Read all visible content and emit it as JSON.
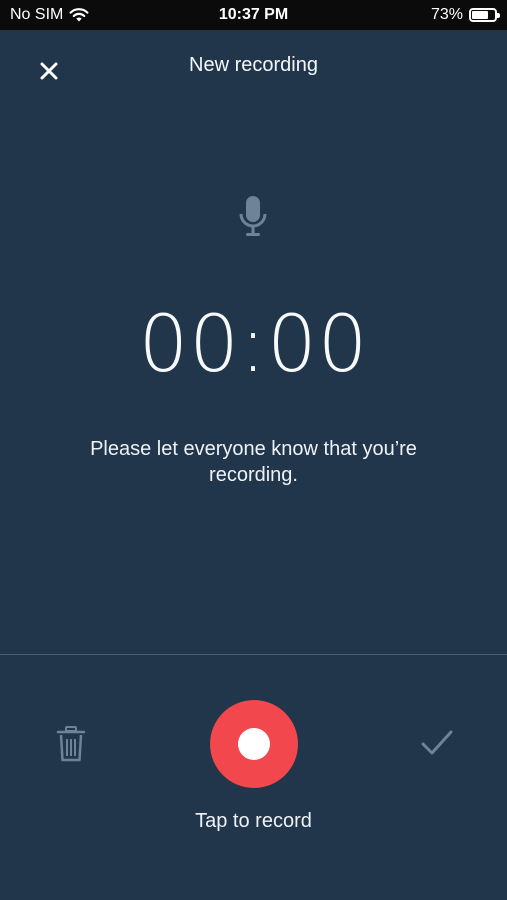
{
  "status_bar": {
    "carrier": "No SIM",
    "time": "10:37 PM",
    "battery_percent": "73%",
    "battery_level": 0.73
  },
  "header": {
    "title": "New recording",
    "close_icon": "close-icon"
  },
  "recorder": {
    "mic_icon": "microphone-icon",
    "timer": "00:00",
    "notice": "Please let everyone know that you’re recording."
  },
  "controls": {
    "delete_icon": "trash-icon",
    "record_label": "Tap to record",
    "confirm_icon": "checkmark-icon"
  },
  "colors": {
    "background": "#21364b",
    "record": "#f1474d",
    "muted_icon": "#6e8398"
  }
}
